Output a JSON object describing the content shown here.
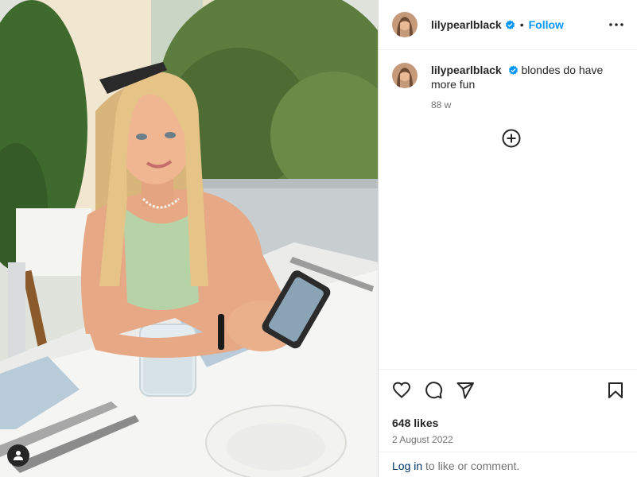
{
  "post": {
    "username": "lilypearlblack",
    "follow_label": "Follow",
    "separator": "•",
    "caption_text": "blondes do have more fun",
    "caption_time": "88 w",
    "likes": "648 likes",
    "date": "2 August 2022"
  },
  "footer": {
    "login_label": "Log in",
    "login_suffix": " to like or comment."
  },
  "icons": {
    "more": "more-options-icon",
    "load_more": "plus-circle-icon",
    "like": "heart-icon",
    "comment": "comment-icon",
    "share": "send-icon",
    "save": "bookmark-icon",
    "verified": "verified-badge-icon",
    "user_tag": "user-tag-icon"
  },
  "colors": {
    "accent": "#0095f6",
    "verified": "#0095f6",
    "text": "#262626",
    "secondary": "#737373",
    "link": "#00376b"
  }
}
